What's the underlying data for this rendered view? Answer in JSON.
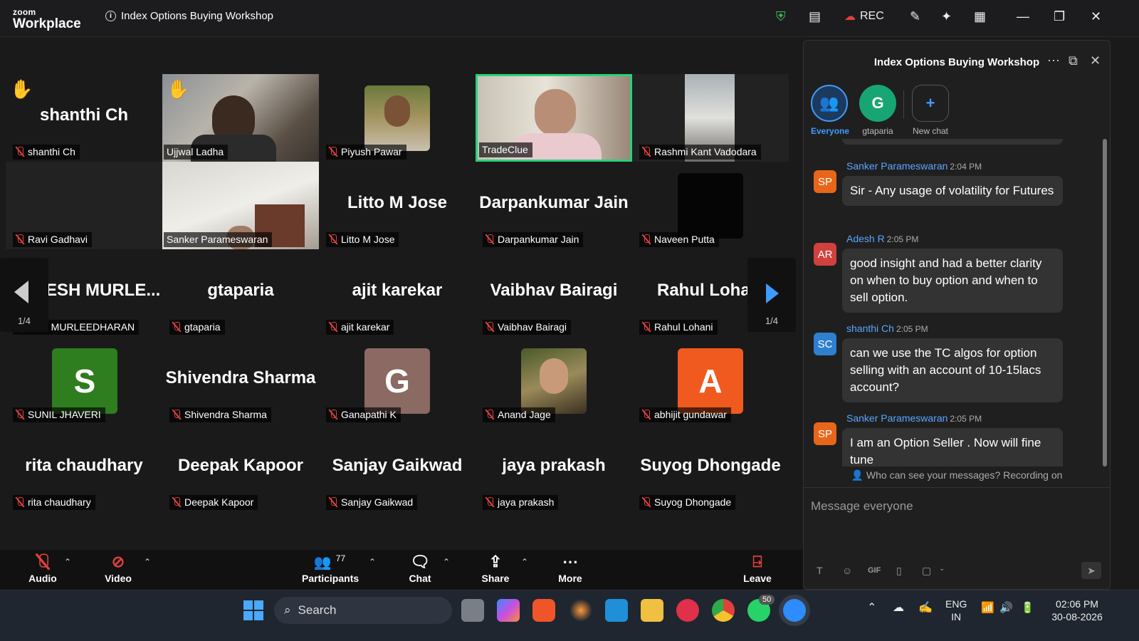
{
  "titlebar": {
    "logo_top": "zoom",
    "logo_bottom": "Workplace",
    "meeting_title": "Index Options Buying Workshop",
    "rec_label": "REC"
  },
  "grid": {
    "row1": [
      {
        "big": "shanthi Ch",
        "label": "shanthi Ch",
        "hand": true
      },
      {
        "big": "",
        "label": "Ujjwal Ladha",
        "hand": true,
        "video": true
      },
      {
        "big": "",
        "label": "Piyush Pawar"
      },
      {
        "big": "",
        "label": "TradeClue",
        "video": true,
        "active": true
      },
      {
        "big": "",
        "label": "Rashmi Kant Vadodara",
        "video": true
      }
    ],
    "row2": [
      {
        "big": "",
        "label": "Ravi Gadhavi"
      },
      {
        "big": "",
        "label": "Sanker Parameswaran",
        "video": true
      },
      {
        "big": "Litto M Jose",
        "label": "Litto M Jose"
      },
      {
        "big": "Darpankumar Jain",
        "label": "Darpankumar Jain"
      },
      {
        "big": "",
        "label": "Naveen Putta"
      }
    ],
    "row3": [
      {
        "big": "ESH  MURLE...",
        "label": "ESH MURLEEDHARAN"
      },
      {
        "big": "gtaparia",
        "label": "gtaparia"
      },
      {
        "big": "ajit karekar",
        "label": "ajit karekar"
      },
      {
        "big": "Vaibhav Bairagi",
        "label": "Vaibhav Bairagi"
      },
      {
        "big": "Rahul Loha",
        "label": "Rahul Lohani"
      }
    ],
    "row4": [
      {
        "big": "",
        "label": "SUNIL JHAVERI",
        "avatar": "S",
        "color": "#2e7d1f"
      },
      {
        "big": "Shivendra Sharma",
        "label": "Shivendra Sharma"
      },
      {
        "big": "",
        "label": "Ganapathi K",
        "avatar": "G",
        "color": "#8a6a62"
      },
      {
        "big": "",
        "label": "Anand Jage"
      },
      {
        "big": "",
        "label": "abhijit gundawar",
        "avatar": "A",
        "color": "#f05a1e"
      }
    ],
    "row5": [
      {
        "big": "rita chaudhary",
        "label": "rita chaudhary"
      },
      {
        "big": "Deepak Kapoor",
        "label": "Deepak Kapoor"
      },
      {
        "big": "Sanjay Gaikwad",
        "label": "Sanjay Gaikwad"
      },
      {
        "big": "jaya prakash",
        "label": "jaya prakash"
      },
      {
        "big": "Suyog Dhongade",
        "label": "Suyog Dhongade"
      }
    ],
    "page_left": "1/4",
    "page_right": "1/4"
  },
  "toolbar": {
    "audio": "Audio",
    "video": "Video",
    "participants": "Participants",
    "participants_count": "77",
    "chat": "Chat",
    "share": "Share",
    "more": "More",
    "leave": "Leave"
  },
  "chat": {
    "title": "Index Options Buying Workshop",
    "tabs": [
      {
        "label": "Everyone"
      },
      {
        "label": "gtaparia",
        "initial": "G"
      },
      {
        "label": "New chat"
      }
    ],
    "messages": [
      {
        "name": "Sanker Parameswaran",
        "time": "2:04 PM",
        "initials": "SP",
        "text": "Sir - Any usage of volatility for Futures",
        "color": "#e8661a"
      },
      {
        "name": "Adesh R",
        "time": "2:05 PM",
        "initials": "AR",
        "text": "good insight and had a better clarity on when to buy option and when to sell option.",
        "color": "#d0413e"
      },
      {
        "name": "shanthi Ch",
        "time": "2:05 PM",
        "initials": "SC",
        "text": "can we use the TC algos for option selling with an account of 10-15lacs account?",
        "color": "#2f7fd0"
      },
      {
        "name": "Sanker Parameswaran",
        "time": "2:05 PM",
        "initials": "SP",
        "text": "I am an Option Seller . Now will fine tune",
        "color": "#e8661a"
      }
    ],
    "notice": "Who can see your messages? Recording on",
    "input_placeholder": "Message everyone"
  },
  "taskbar": {
    "search": "Search",
    "badge": "50",
    "lang1": "ENG",
    "lang2": "IN",
    "time": "02:06 PM",
    "date": "30-08-2026"
  }
}
